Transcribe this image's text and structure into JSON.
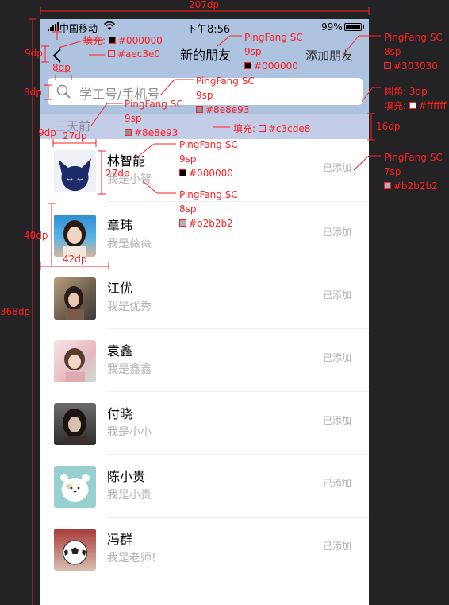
{
  "status_bar": {
    "carrier": "中国移动",
    "time": "下午8:56",
    "battery": "99%",
    "battery_level": 0.99
  },
  "nav": {
    "title": "新的朋友",
    "add_label": "添加朋友"
  },
  "search": {
    "placeholder": "学工号/手机号"
  },
  "section_label": "三天前",
  "friends": [
    {
      "name": "林智能",
      "subtitle": "我是小智",
      "status": "已添加",
      "avatar": "cat-logo-avatar"
    },
    {
      "name": "章玮",
      "subtitle": "我是薇薇",
      "status": "已添加",
      "avatar": "girl-photo-avatar"
    },
    {
      "name": "江优",
      "subtitle": "我是优秀",
      "status": "已添加",
      "avatar": "girl-photo-avatar"
    },
    {
      "name": "袁鑫",
      "subtitle": "我是鑫鑫",
      "status": "已添加",
      "avatar": "girl-photo-avatar"
    },
    {
      "name": "付晓",
      "subtitle": "我是小小",
      "status": "已添加",
      "avatar": "girl-photo-avatar"
    },
    {
      "name": "陈小贵",
      "subtitle": "我是小贵",
      "status": "已添加",
      "avatar": "bear-avatar"
    },
    {
      "name": "冯群",
      "subtitle": "我是老师!",
      "status": "已添加",
      "avatar": "soccer-ball-avatar"
    }
  ],
  "annotations": {
    "width_total": "207dp",
    "height_total": "368dp",
    "back_size": "9dp",
    "back_width": "8dp",
    "back_fill_label": "填充:",
    "back_fill_color": "#000000",
    "header_fill_color": "#aec3e0",
    "title_font": "PingFang SC",
    "title_size": "9sp",
    "title_color": "#000000",
    "add_font": "PingFang SC",
    "add_size": "8sp",
    "add_color": "#303030",
    "search_height": "8dp",
    "search_font": "PingFang SC",
    "search_size": "9sp",
    "search_color": "#8e8e93",
    "search_radius_label": "圆角:",
    "search_radius": "3dp",
    "search_fill_label": "填充:",
    "search_fill": "#ffffff",
    "section_font": "PingFang SC",
    "section_size": "9sp",
    "section_color": "#8e8e93",
    "section_fill_label": "填充:",
    "section_fill": "#c3cde8",
    "section_height": "16dp",
    "section_left": "9dp",
    "avatar_small": "27dp",
    "row_height_text": "27dp",
    "name_font": "PingFang SC",
    "name_size": "9sp",
    "name_color": "#000000",
    "sub_font": "PingFang SC",
    "sub_size": "8sp",
    "sub_color": "#b2b2b2",
    "status_font": "PingFang SC",
    "status_size": "7sp",
    "status_color": "#b2b2b2",
    "avatar_height": "40dp",
    "avatar_width": "42dp"
  }
}
